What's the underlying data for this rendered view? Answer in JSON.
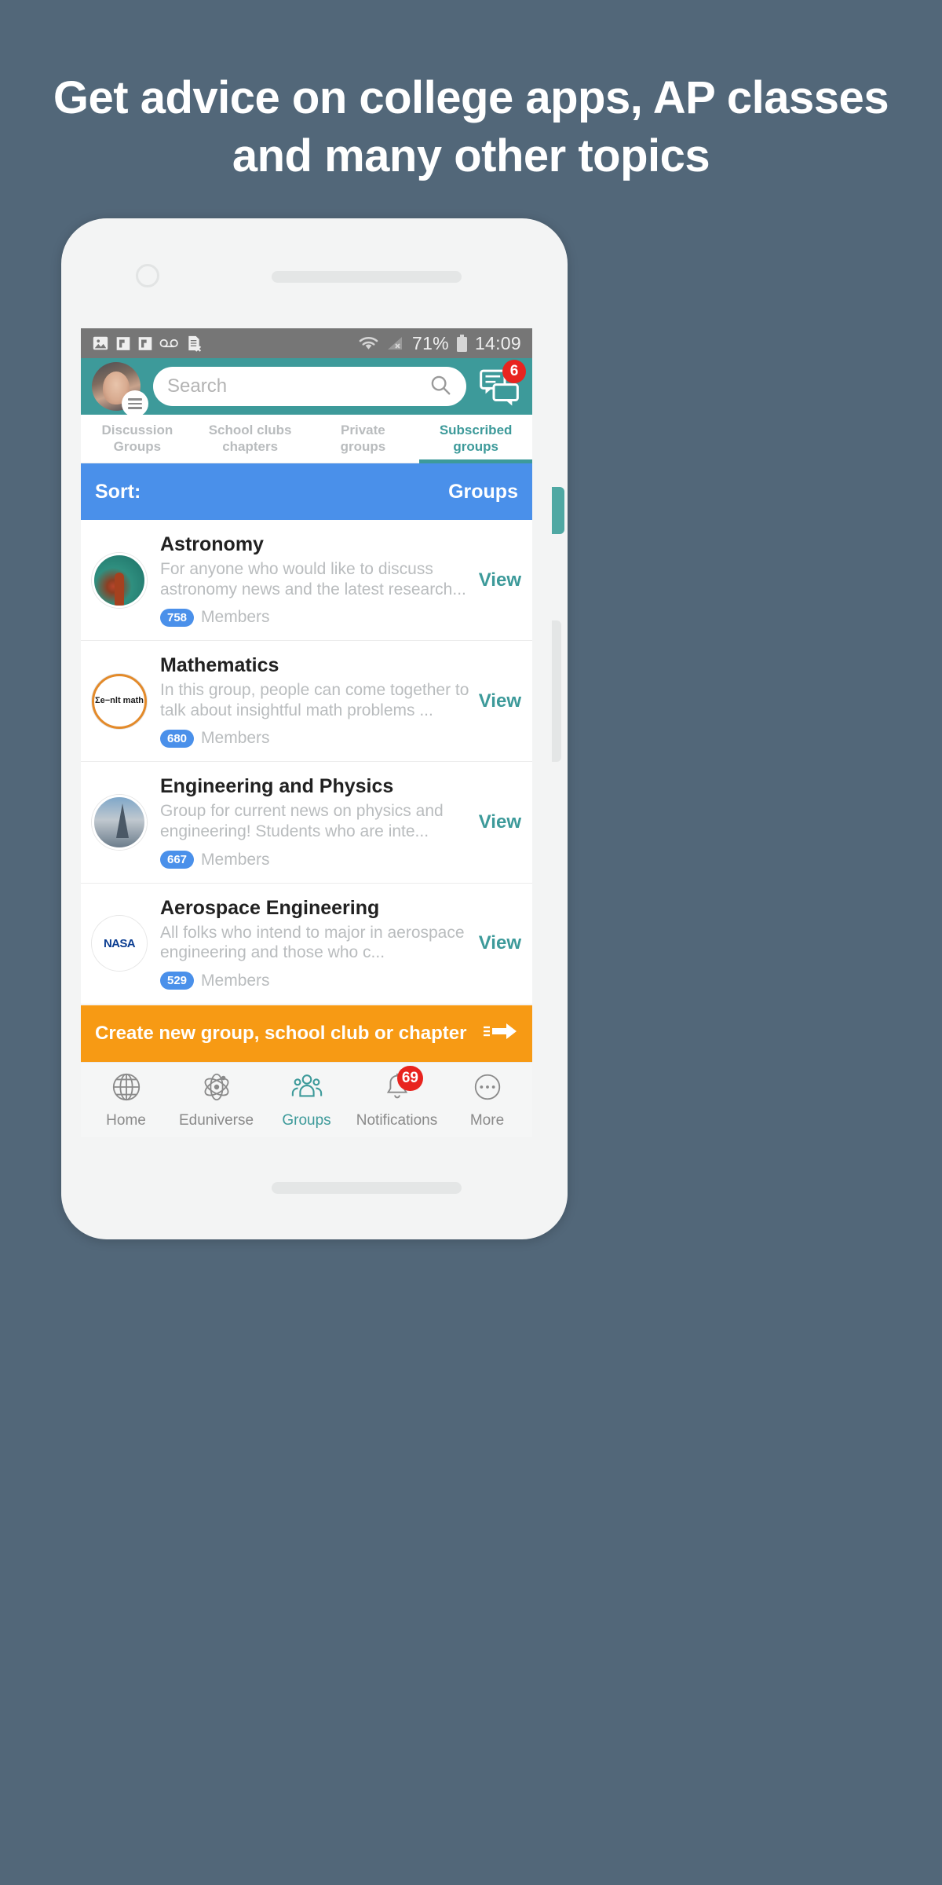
{
  "headline": "Get advice on college apps, AP classes and many other topics",
  "status_bar": {
    "icons": [
      "image-icon",
      "flag-icon",
      "flag-icon",
      "voicemail-icon",
      "sim-card-error-icon",
      "wifi-icon",
      "signal-off-icon"
    ],
    "battery_percent": "71%",
    "time": "14:09"
  },
  "topbar": {
    "avatar_name": "user-avatar",
    "menu_label": "menu",
    "search": {
      "placeholder": "Search",
      "value": ""
    },
    "messages_badge": "6"
  },
  "tabs": [
    {
      "label": "Discussion Groups",
      "line1": "Discussion",
      "line2": "Groups",
      "active": false
    },
    {
      "label": "School clubs chapters",
      "line1": "School clubs",
      "line2": "chapters",
      "active": false
    },
    {
      "label": "Private groups",
      "line1": "Private",
      "line2": "groups",
      "active": false
    },
    {
      "label": "Subscribed groups",
      "line1": "Subscribed",
      "line2": "groups",
      "active": true
    }
  ],
  "sortbar": {
    "left_label": "Sort:",
    "right_label": "Groups"
  },
  "groups": [
    {
      "name": "Astronomy",
      "description": "For anyone who would like to discuss astronomy news and the latest research...",
      "members_count": "758",
      "members_label": "Members",
      "action": "View",
      "avatar": "astronomy-nebula-avatar"
    },
    {
      "name": "Mathematics",
      "description": "In this group, people can come together to talk about insightful math problems ...",
      "members_count": "680",
      "members_label": "Members",
      "action": "View",
      "avatar": "math-formula-avatar",
      "avatar_text": "Σe−nlt math"
    },
    {
      "name": "Engineering and Physics",
      "description": "Group for current news on physics and engineering! Students who are inte...",
      "members_count": "667",
      "members_label": "Members",
      "action": "View",
      "avatar": "eiffel-tower-avatar"
    },
    {
      "name": "Aerospace Engineering",
      "description": "All folks who intend to major in aerospace engineering and those who c...",
      "members_count": "529",
      "members_label": "Members",
      "action": "View",
      "avatar": "nasa-logo-avatar",
      "avatar_text": "NASA"
    }
  ],
  "cta": {
    "label": "Create new group, school club or chapter",
    "icon": "arrow-right-icon"
  },
  "bottom_nav": [
    {
      "label": "Home",
      "icon": "globe-icon",
      "active": false,
      "badge": ""
    },
    {
      "label": "Eduniverse",
      "icon": "atom-icon",
      "active": false,
      "badge": ""
    },
    {
      "label": "Groups",
      "icon": "people-group-icon",
      "active": true,
      "badge": ""
    },
    {
      "label": "Notifications",
      "icon": "bell-icon",
      "active": false,
      "badge": "69"
    },
    {
      "label": "More",
      "icon": "more-dots-icon",
      "active": false,
      "badge": ""
    }
  ],
  "colors": {
    "background": "#526779",
    "teal": "#3d9a9a",
    "blue": "#4a90ea",
    "orange": "#f79a14",
    "red": "#e8241f"
  }
}
